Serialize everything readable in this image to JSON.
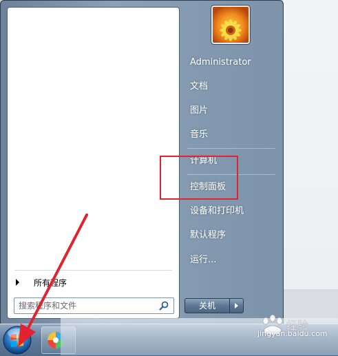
{
  "start_menu": {
    "all_programs_label": "所有程序",
    "search_placeholder": "搜索程序和文件",
    "right_items": [
      {
        "label": "Administrator"
      },
      {
        "label": "文档"
      },
      {
        "label": "图片"
      },
      {
        "label": "音乐"
      },
      {
        "label": "计算机"
      },
      {
        "label": "控制面板"
      },
      {
        "label": "设备和打印机"
      },
      {
        "label": "默认程序"
      },
      {
        "label": "运行..."
      }
    ],
    "shutdown_label": "关机"
  },
  "icons": {
    "avatar": "flower-avatar",
    "search": "search-icon",
    "start_orb": "windows-start-orb",
    "taskbar_app": "app-icon"
  },
  "colors": {
    "highlight": "#e3212f",
    "arrow": "#e3212f",
    "menu_frame": "#7d93aa"
  },
  "watermark": {
    "brand": "Baidu 经验",
    "url": "jingyan.baidu.com"
  }
}
